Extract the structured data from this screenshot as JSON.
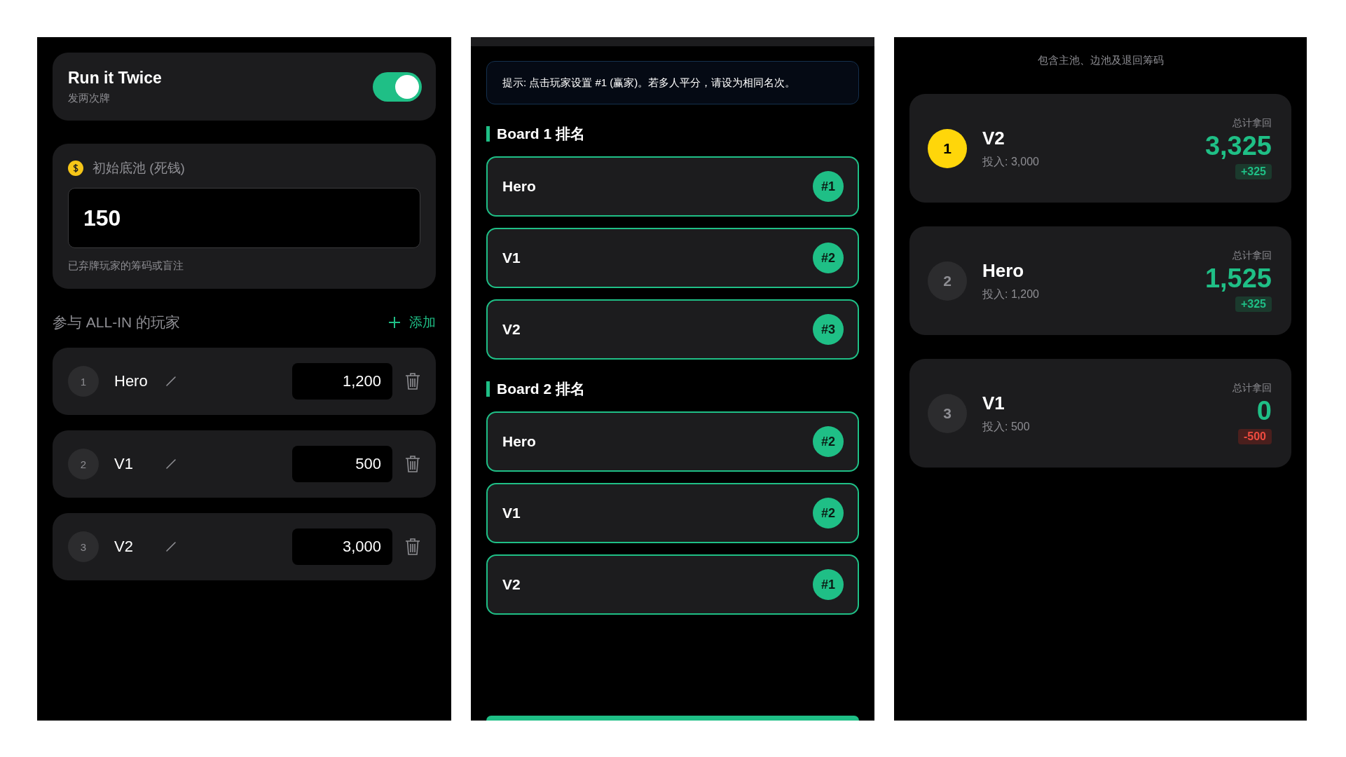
{
  "settings": {
    "run_it_twice": {
      "title": "Run it Twice",
      "subtitle": "发两次牌",
      "on": true
    },
    "dead_money": {
      "label": "初始底池 (死钱)",
      "value": "150",
      "hint": "已弃牌玩家的筹码或盲注"
    },
    "players_header": {
      "title": "参与 ALL-IN 的玩家",
      "add": "添加"
    },
    "players": [
      {
        "index": "1",
        "name": "Hero",
        "amount": "1,200"
      },
      {
        "index": "2",
        "name": "V1",
        "amount": "500"
      },
      {
        "index": "3",
        "name": "V2",
        "amount": "3,000"
      }
    ]
  },
  "ranking": {
    "hint": "提示: 点击玩家设置 #1 (赢家)。若多人平分，请设为相同名次。",
    "boards": [
      {
        "title": "Board 1 排名",
        "rows": [
          {
            "name": "Hero",
            "rank": "#1"
          },
          {
            "name": "V1",
            "rank": "#2"
          },
          {
            "name": "V2",
            "rank": "#3"
          }
        ]
      },
      {
        "title": "Board 2 排名",
        "rows": [
          {
            "name": "Hero",
            "rank": "#2"
          },
          {
            "name": "V1",
            "rank": "#2"
          },
          {
            "name": "V2",
            "rank": "#1"
          }
        ]
      }
    ]
  },
  "results": {
    "subtitle": "包含主池、边池及退回筹码",
    "players": [
      {
        "rank": "1",
        "winner": true,
        "name": "V2",
        "invested": "投入: 3,000",
        "total_label": "总计拿回",
        "total": "3,325",
        "delta": "+325",
        "kind": "gain"
      },
      {
        "rank": "2",
        "winner": false,
        "name": "Hero",
        "invested": "投入: 1,200",
        "total_label": "总计拿回",
        "total": "1,525",
        "delta": "+325",
        "kind": "gain"
      },
      {
        "rank": "3",
        "winner": false,
        "name": "V1",
        "invested": "投入: 500",
        "total_label": "总计拿回",
        "total": "0",
        "delta": "-500",
        "kind": "loss"
      }
    ]
  }
}
